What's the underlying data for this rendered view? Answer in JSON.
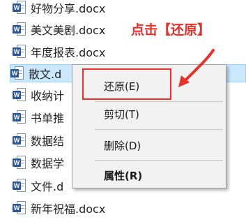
{
  "files": [
    {
      "name": "好物分享.docx",
      "icon": "word-doc-icon"
    },
    {
      "name": "美文美剧.docx",
      "icon": "word-doc-icon"
    },
    {
      "name": "年度报表.docx",
      "icon": "word-doc-icon"
    },
    {
      "name": "散文.d",
      "icon": "word-doc-icon",
      "selected": true
    },
    {
      "name": "收纳计",
      "icon": "word-doc-icon"
    },
    {
      "name": "书单推",
      "icon": "word-doc-icon"
    },
    {
      "name": "数据结",
      "icon": "word-doc-icon"
    },
    {
      "name": "数据学",
      "icon": "word-doc-icon"
    },
    {
      "name": "文件.d",
      "icon": "word-doc-icon"
    },
    {
      "name": "新年祝福.docx",
      "icon": "word-doc-icon"
    }
  ],
  "word_badge": "W",
  "annotation": {
    "text": "点击【还原】",
    "color": "#e8312b"
  },
  "context_menu": {
    "restore_label": "还原(E)",
    "cut_label": "剪切(T)",
    "delete_label": "删除(D)",
    "properties_label": "属性(R)"
  },
  "colors": {
    "accent_red": "#e8312b",
    "selection_bg": "#cce8ff",
    "menu_bg": "#f2f2f2"
  }
}
